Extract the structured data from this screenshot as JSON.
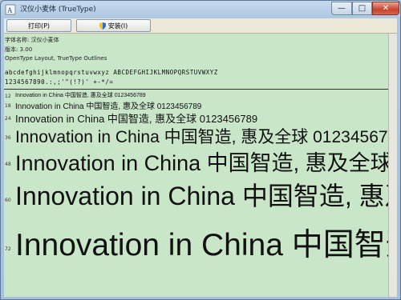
{
  "window": {
    "title": "汉仪小麦体 (TrueType)"
  },
  "toolbar": {
    "print_label": "打印(P)",
    "install_label": "安装(I)"
  },
  "font_info": {
    "name_line": "字体名称: 汉仪小麦体",
    "version_line": "版本: 3.00",
    "format_line": "OpenType Layout, TrueType Outlines",
    "alphabet": "abcdefghijklmnopqrstuvwxyz ABCDEFGHIJKLMNOPQRSTUVWXYZ",
    "numerals": "1234567890.:,;'\"(!?)' +-*/= "
  },
  "sample_text": "Innovation in China 中国智造, 惠及全球 0123456789",
  "samples": [
    {
      "size": "12"
    },
    {
      "size": "18"
    },
    {
      "size": "24"
    },
    {
      "size": "36"
    },
    {
      "size": "48"
    },
    {
      "size": "60"
    },
    {
      "size": "72"
    }
  ],
  "colors": {
    "content_bg": "#c9e6c9",
    "frame": "#a9c3dd",
    "close_button": "#c7442c"
  }
}
